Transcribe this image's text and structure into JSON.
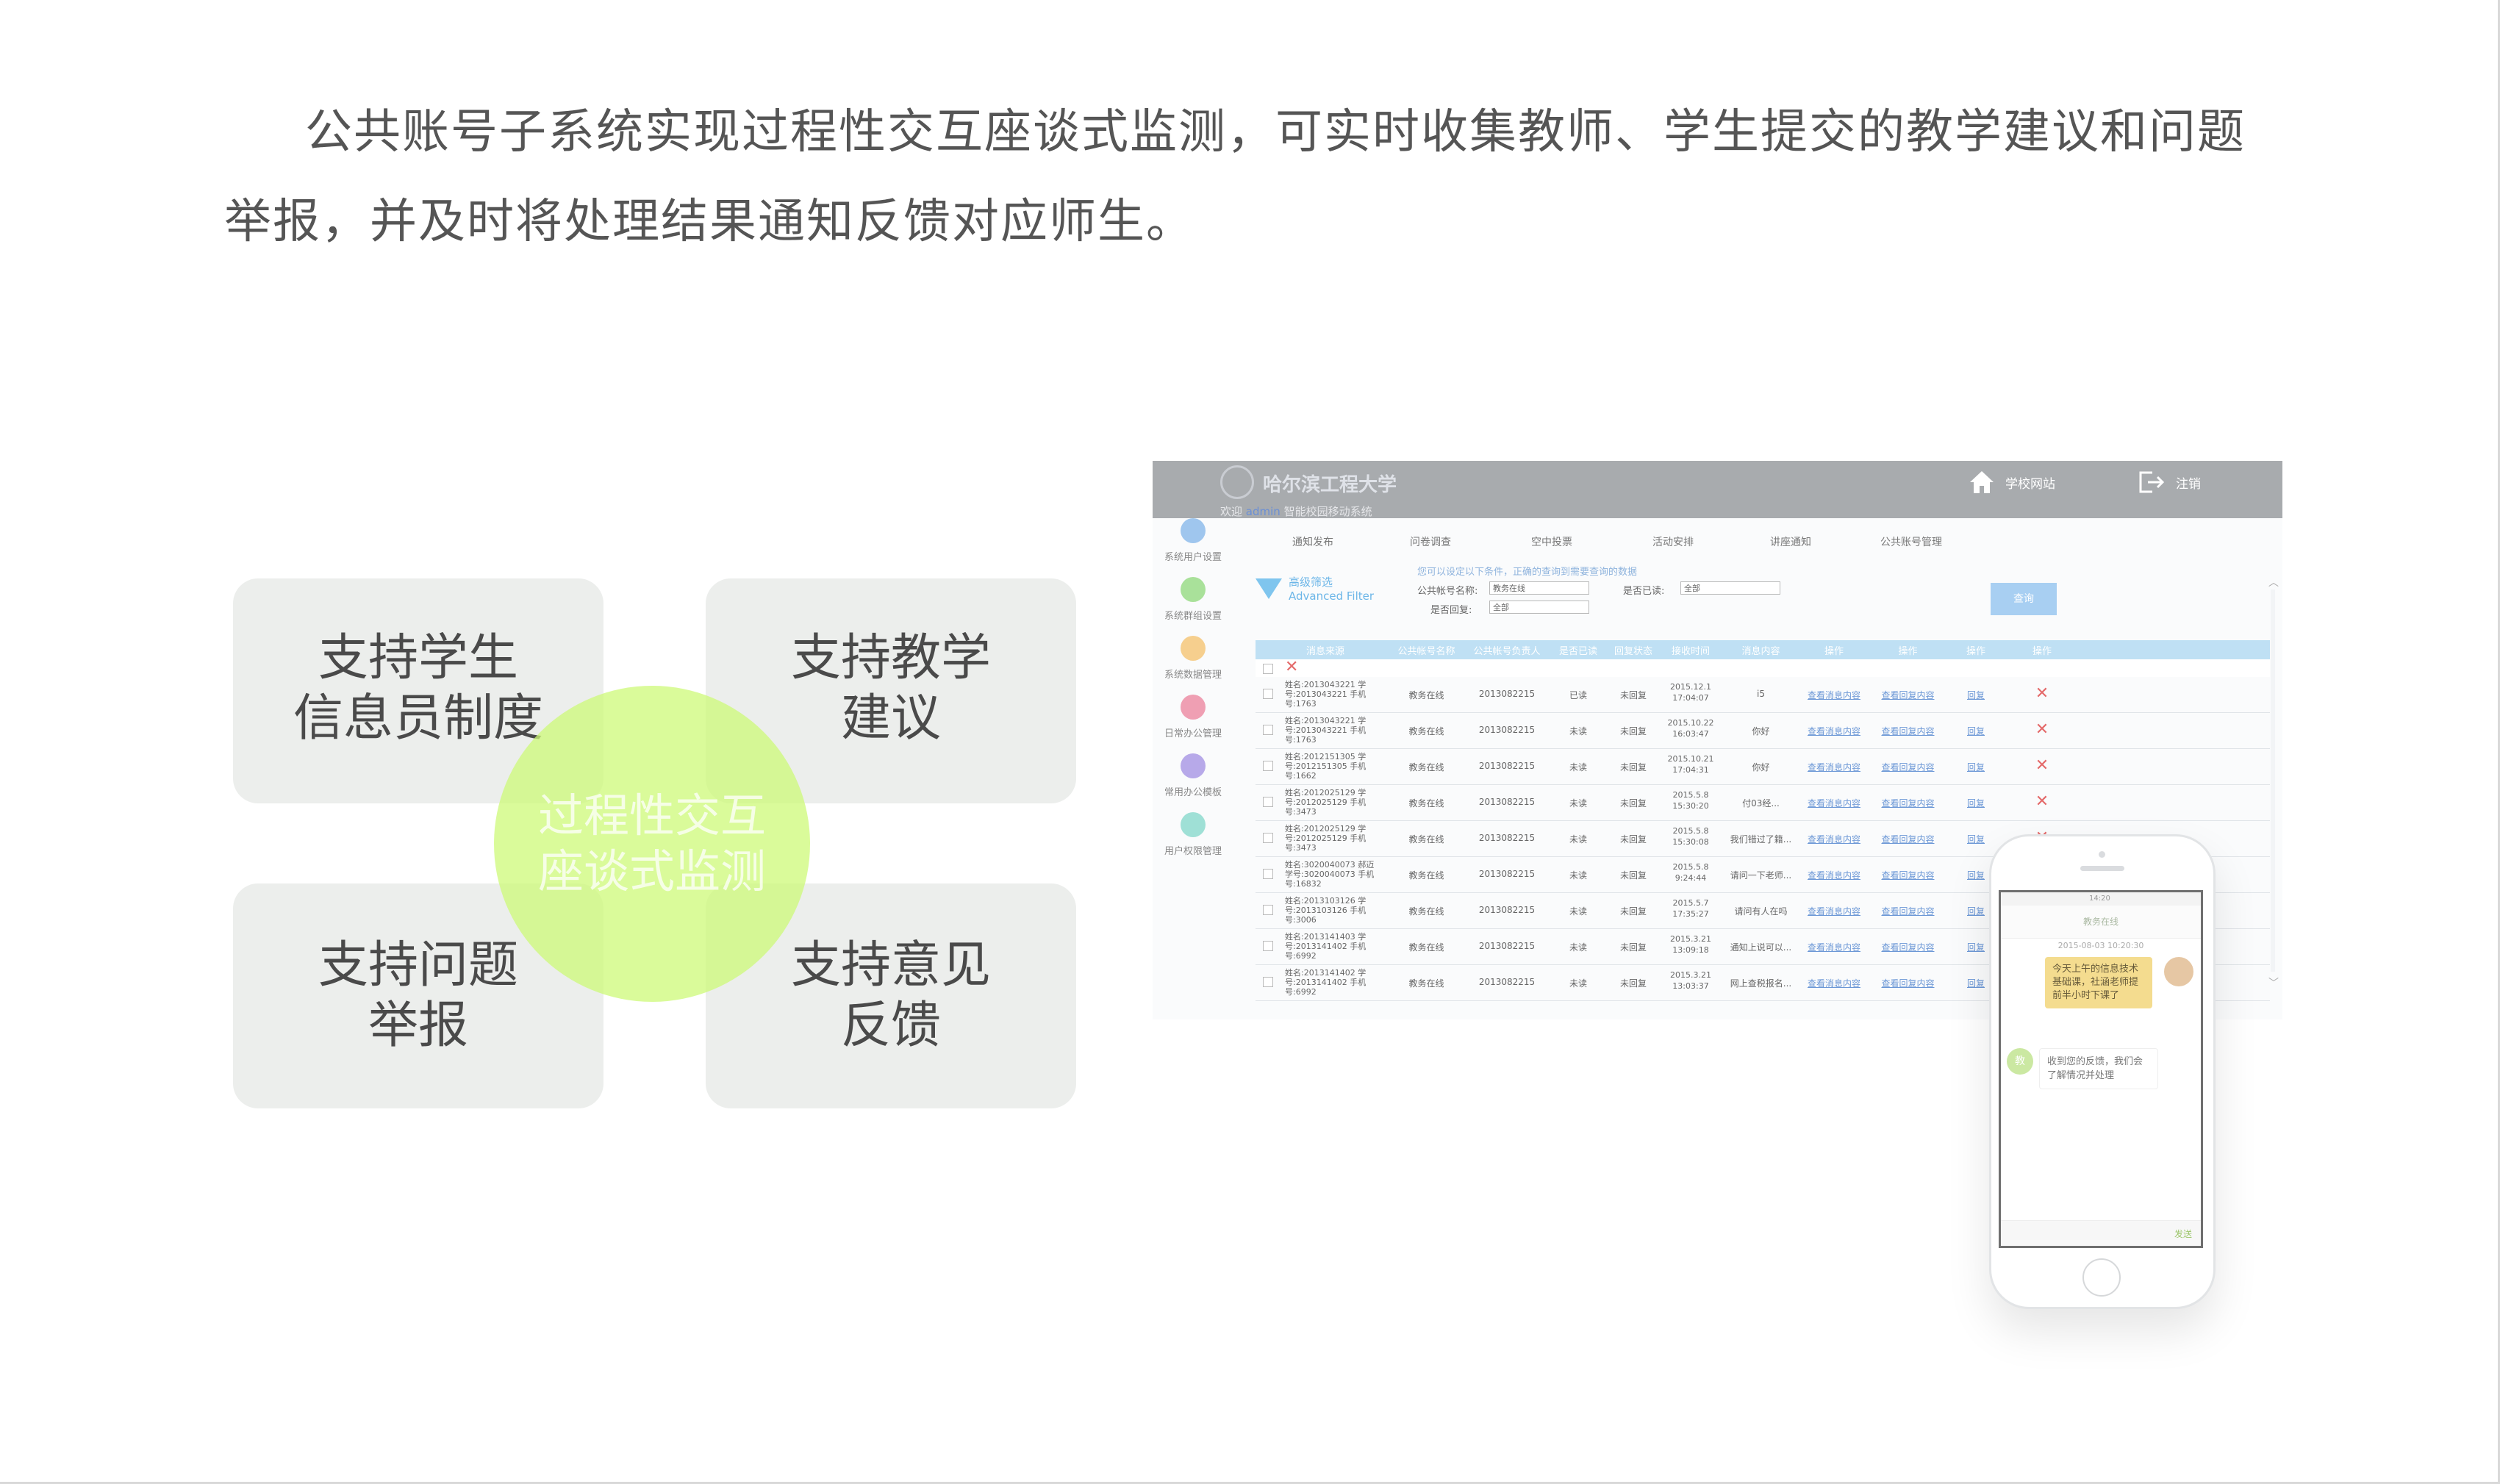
{
  "intro": {
    "text": "公共账号子系统实现过程性交互座谈式监测，可实时收集教师、学生提交的教学建议和问题举报，并及时将处理结果通知反馈对应师生。"
  },
  "features": {
    "student_informant": "支持学生\n信息员制度",
    "teaching_advice": "支持教学\n建议",
    "problem_report": "支持问题\n举报",
    "feedback": "支持意见\n反馈",
    "center": "过程性交互\n座谈式监测"
  },
  "colors": {
    "tile_bg": "#eceeec",
    "circle": "#cdfa78",
    "header_bg": "#a8abae",
    "table_head": "#bfe0f4",
    "link": "#6b97d6",
    "delete": "#e46b6b"
  },
  "screenshot": {
    "logo_text": "哈尔滨工程大学",
    "welcome_prefix": "欢迎",
    "welcome_user": "admin",
    "welcome_suffix": "智能校园移动系统",
    "home_link": "学校网站",
    "logout_link": "注销",
    "home_icon": "home-icon",
    "logout_icon": "logout-icon",
    "sidebar": [
      {
        "label": "系统用户设置",
        "color": "#9fc6ee",
        "icon": "user-icon"
      },
      {
        "label": "系统群组设置",
        "color": "#a9e19a",
        "icon": "group-icon"
      },
      {
        "label": "系统数据管理",
        "color": "#f6cf8e",
        "icon": "data-icon"
      },
      {
        "label": "日常办公管理",
        "color": "#ef9fb3",
        "icon": "office-icon"
      },
      {
        "label": "常用办公模板",
        "color": "#b7a9e9",
        "icon": "template-icon"
      },
      {
        "label": "用户权限管理",
        "color": "#9fe0d6",
        "icon": "key-icon"
      }
    ],
    "tabs": [
      "通知发布",
      "问卷调查",
      "空中投票",
      "活动安排",
      "讲座通知",
      "公共账号管理"
    ],
    "filter": {
      "title_cn": "高级筛选",
      "title_en": "Advanced Filter",
      "hint": "您可以设定以下条件，正确的查询到需要查询的数据",
      "account_label": "公共帐号名称:",
      "account_value": "教务在线",
      "read_label": "是否已读:",
      "read_value": "全部",
      "reply_label": "是否回复:",
      "reply_value": "全部",
      "button": "查询"
    },
    "table": {
      "headers": [
        "消息来源",
        "公共帐号名称",
        "公共帐号负责人",
        "是否已读",
        "回复状态",
        "接收时间",
        "消息内容",
        "操作",
        "操作",
        "操作",
        "操作"
      ],
      "rows": [
        {
          "sender": "姓名:2013043221 学号:2013043221 手机号:1763",
          "account": "教务在线",
          "owner": "2013082215",
          "read": "已读",
          "reply": "未回复",
          "time": "2015.12.1 17:04:07",
          "content": "i5",
          "op1": "查看消息内容",
          "op2": "查看回复内容",
          "op3": "回复"
        },
        {
          "sender": "姓名:2013043221 学号:2013043221 手机号:1763",
          "account": "教务在线",
          "owner": "2013082215",
          "read": "未读",
          "reply": "未回复",
          "time": "2015.10.22 16:03:47",
          "content": "你好",
          "op1": "查看消息内容",
          "op2": "查看回复内容",
          "op3": "回复"
        },
        {
          "sender": "姓名:2012151305 学号:2012151305 手机号:1662",
          "account": "教务在线",
          "owner": "2013082215",
          "read": "未读",
          "reply": "未回复",
          "time": "2015.10.21 17:04:31",
          "content": "你好",
          "op1": "查看消息内容",
          "op2": "查看回复内容",
          "op3": "回复"
        },
        {
          "sender": "姓名:2012025129 学号:2012025129 手机号:3473",
          "account": "教务在线",
          "owner": "2013082215",
          "read": "未读",
          "reply": "未回复",
          "time": "2015.5.8 15:30:20",
          "content": "付03经...",
          "op1": "查看消息内容",
          "op2": "查看回复内容",
          "op3": "回复"
        },
        {
          "sender": "姓名:2012025129 学号:2012025129 手机号:3473",
          "account": "教务在线",
          "owner": "2013082215",
          "read": "未读",
          "reply": "未回复",
          "time": "2015.5.8 15:30:08",
          "content": "我们错过了籍...",
          "op1": "查看消息内容",
          "op2": "查看回复内容",
          "op3": "回复"
        },
        {
          "sender": "姓名:3020040073 郝迈 学号:3020040073 手机号:16832",
          "account": "教务在线",
          "owner": "2013082215",
          "read": "未读",
          "reply": "未回复",
          "time": "2015.5.8 9:24:44",
          "content": "请问一下老师...",
          "op1": "查看消息内容",
          "op2": "查看回复内容",
          "op3": "回复"
        },
        {
          "sender": "姓名:2013103126 学号:2013103126 手机号:3006",
          "account": "教务在线",
          "owner": "2013082215",
          "read": "未读",
          "reply": "未回复",
          "time": "2015.5.7 17:35:27",
          "content": "请问有人在吗",
          "op1": "查看消息内容",
          "op2": "查看回复内容",
          "op3": "回复"
        },
        {
          "sender": "姓名:2013141403 学号:2013141402 手机号:6992",
          "account": "教务在线",
          "owner": "2013082215",
          "read": "未读",
          "reply": "未回复",
          "time": "2015.3.21 13:09:18",
          "content": "通知上说可以...",
          "op1": "查看消息内容",
          "op2": "查看回复内容",
          "op3": "回复"
        },
        {
          "sender": "姓名:2013141402 学号:2013141402 手机号:6992",
          "account": "教务在线",
          "owner": "2013082215",
          "read": "未读",
          "reply": "未回复",
          "time": "2015.3.21 13:03:37",
          "content": "网上查税报名...",
          "op1": "查看消息内容",
          "op2": "查看回复内容",
          "op3": "回复"
        }
      ]
    }
  },
  "phone": {
    "status_time": "14:20",
    "header": "教务在线",
    "timestamp": "2015-08-03 10:20:30",
    "bubble_me": "今天上午的信息技术基础课，社涵老师提前半小时下课了",
    "bubble_other": "收到您的反馈，我们会了解情况并处理",
    "avatar_other": "教",
    "send": "发送"
  }
}
